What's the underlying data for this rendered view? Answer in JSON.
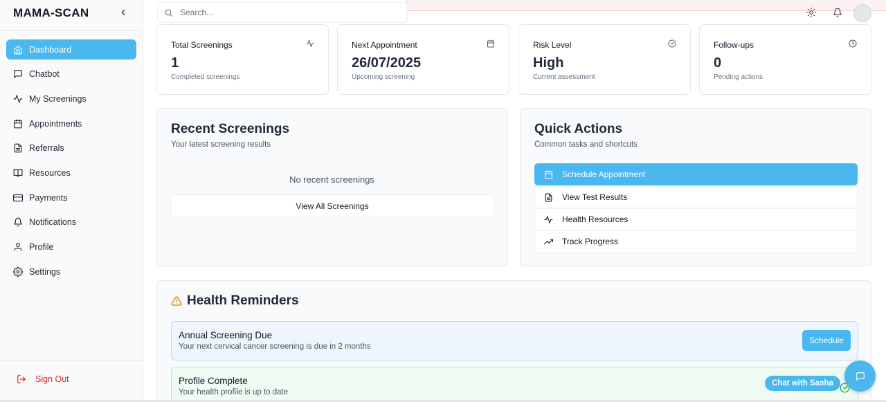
{
  "brand": "MAMA-SCAN",
  "sidebar": {
    "items": [
      {
        "label": "Dashboard",
        "icon": "home-icon",
        "active": true
      },
      {
        "label": "Chatbot",
        "icon": "message-square-icon"
      },
      {
        "label": "My Screenings",
        "icon": "activity-icon"
      },
      {
        "label": "Appointments",
        "icon": "calendar-icon"
      },
      {
        "label": "Referrals",
        "icon": "file-text-icon"
      },
      {
        "label": "Resources",
        "icon": "book-open-icon"
      },
      {
        "label": "Payments",
        "icon": "credit-card-icon"
      },
      {
        "label": "Notifications",
        "icon": "bell-icon"
      },
      {
        "label": "Profile",
        "icon": "user-icon"
      },
      {
        "label": "Settings",
        "icon": "gear-icon"
      }
    ],
    "signout": "Sign Out"
  },
  "search": {
    "placeholder": "Search..."
  },
  "stats": [
    {
      "title": "Total Screenings",
      "value": "1",
      "sub": "Completed screenings",
      "icon": "activity-icon"
    },
    {
      "title": "Next Appointment",
      "value": "26/07/2025",
      "sub": "Upcoming screening",
      "icon": "calendar-icon"
    },
    {
      "title": "Risk Level",
      "value": "High",
      "sub": "Current assessment",
      "icon": "check-circle-icon"
    },
    {
      "title": "Follow-ups",
      "value": "0",
      "sub": "Pending actions",
      "icon": "clock-icon"
    }
  ],
  "recent": {
    "title": "Recent Screenings",
    "subtitle": "Your latest screening results",
    "empty": "No recent screenings",
    "button": "View All Screenings"
  },
  "quick": {
    "title": "Quick Actions",
    "subtitle": "Common tasks and shortcuts",
    "actions": [
      {
        "label": "Schedule Appointment",
        "icon": "calendar-icon"
      },
      {
        "label": "View Test Results",
        "icon": "file-text-icon"
      },
      {
        "label": "Health Resources",
        "icon": "activity-icon"
      },
      {
        "label": "Track Progress",
        "icon": "trending-up-icon"
      }
    ]
  },
  "reminders": {
    "title": "Health Reminders",
    "items": [
      {
        "title": "Annual Screening Due",
        "desc": "Your next cervical cancer screening is due in 2 months",
        "button": "Schedule"
      },
      {
        "title": "Profile Complete",
        "desc": "Your health profile is up to date"
      }
    ]
  },
  "chat": {
    "label": "Chat with Sasha"
  },
  "colors": {
    "accent": "#4ab7ef",
    "danger": "#dc2626",
    "warning": "#d97706",
    "success": "#16a34a"
  }
}
